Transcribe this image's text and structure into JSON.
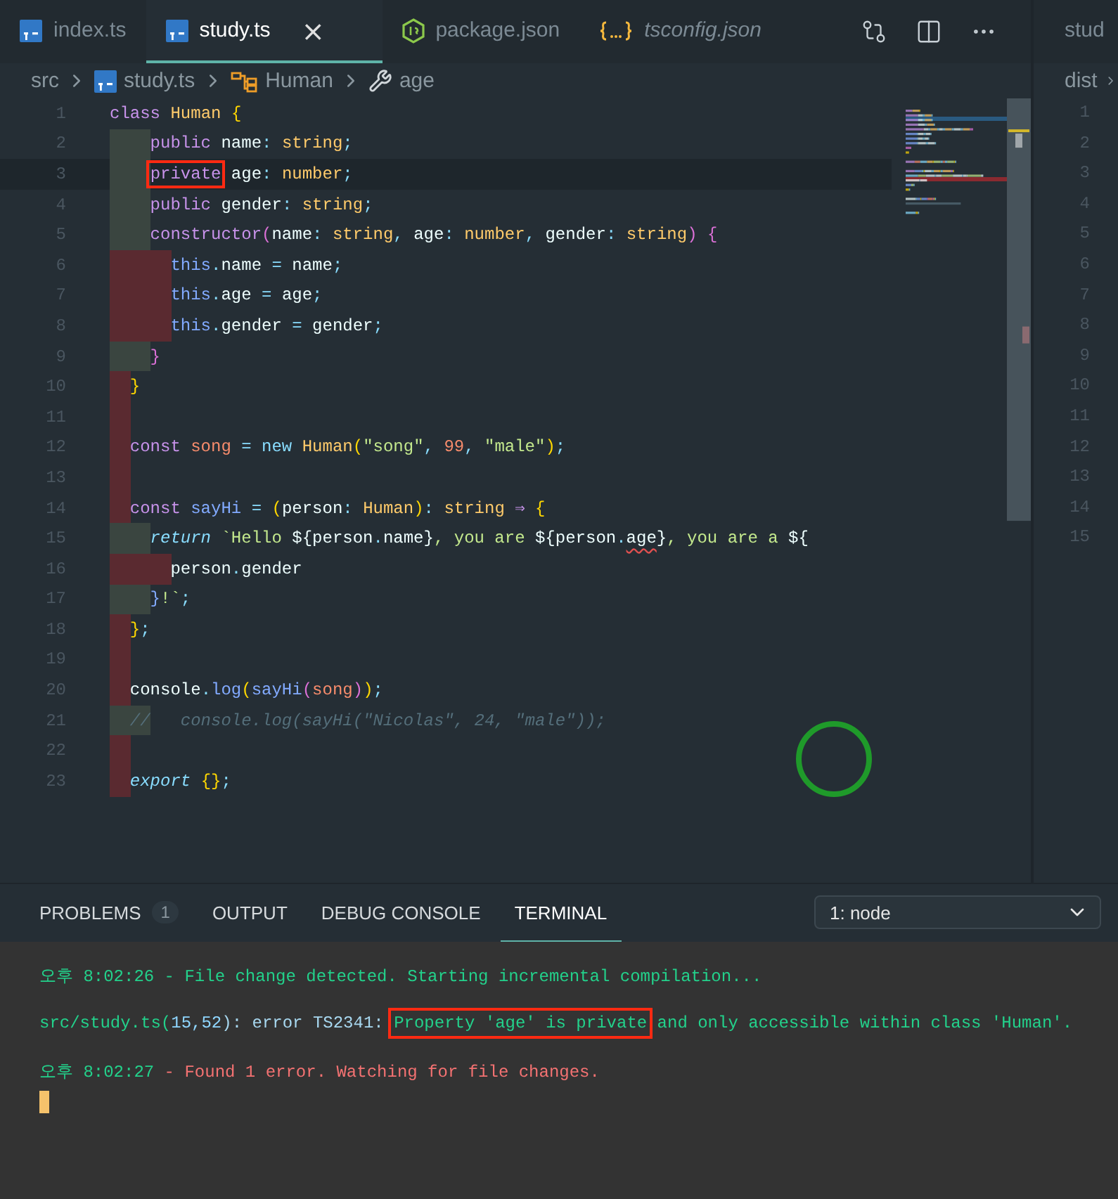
{
  "tabs": [
    {
      "label": "index.ts",
      "kind": "ts",
      "selected": false,
      "preview": false
    },
    {
      "label": "study.ts",
      "kind": "ts",
      "selected": true,
      "preview": false,
      "close": "×"
    },
    {
      "label": "package.json",
      "kind": "node",
      "selected": false,
      "preview": false
    },
    {
      "label": "tsconfig.json",
      "kind": "json",
      "selected": false,
      "preview": true
    }
  ],
  "breadcrumb": [
    {
      "label": "src",
      "kind": "folder"
    },
    {
      "label": "study.ts",
      "kind": "ts"
    },
    {
      "label": "Human",
      "kind": "class"
    },
    {
      "label": "age",
      "kind": "property"
    }
  ],
  "lines": [
    {
      "number": "1",
      "tokens": [
        {
          "kind": "kw",
          "text": "class "
        },
        {
          "kind": "type",
          "text": "Human "
        },
        {
          "kind": "brace",
          "text": "{"
        }
      ]
    },
    {
      "number": "2",
      "guides": [
        {
          "kind": "ok"
        },
        {
          "kind": "ok"
        }
      ],
      "tokens": [
        {
          "kind": "kw",
          "text": "    public "
        },
        {
          "kind": "id",
          "text": "name"
        },
        {
          "kind": "punct",
          "text": ": "
        },
        {
          "kind": "type",
          "text": "string"
        },
        {
          "kind": "punct",
          "text": ";"
        }
      ]
    },
    {
      "number": "3",
      "current": true,
      "guides": [
        {
          "kind": "ok"
        },
        {
          "kind": "ok"
        }
      ],
      "tokens": [
        {
          "kind": "kw",
          "text": "    private",
          "boxed": true
        },
        {
          "kind": "id",
          "text": " age"
        },
        {
          "kind": "punct",
          "text": ": "
        },
        {
          "kind": "type",
          "text": "number"
        },
        {
          "kind": "punct",
          "text": ";"
        }
      ]
    },
    {
      "number": "4",
      "guides": [
        {
          "kind": "ok"
        },
        {
          "kind": "ok"
        }
      ],
      "tokens": [
        {
          "kind": "kw",
          "text": "    public "
        },
        {
          "kind": "id",
          "text": "gender"
        },
        {
          "kind": "punct",
          "text": ": "
        },
        {
          "kind": "type",
          "text": "string"
        },
        {
          "kind": "punct",
          "text": ";"
        }
      ]
    },
    {
      "number": "5",
      "guides": [
        {
          "kind": "ok"
        },
        {
          "kind": "ok"
        }
      ],
      "tokens": [
        {
          "kind": "kw",
          "text": "    constructor"
        },
        {
          "kind": "paren",
          "text": "("
        },
        {
          "kind": "id",
          "text": "name"
        },
        {
          "kind": "punct",
          "text": ": "
        },
        {
          "kind": "type",
          "text": "string"
        },
        {
          "kind": "punct",
          "text": ", "
        },
        {
          "kind": "id",
          "text": "age"
        },
        {
          "kind": "punct",
          "text": ": "
        },
        {
          "kind": "type",
          "text": "number"
        },
        {
          "kind": "punct",
          "text": ", "
        },
        {
          "kind": "id",
          "text": "gender"
        },
        {
          "kind": "punct",
          "text": ": "
        },
        {
          "kind": "type",
          "text": "string"
        },
        {
          "kind": "paren",
          "text": ") {"
        }
      ]
    },
    {
      "number": "6",
      "guides": [
        {
          "kind": "err"
        },
        {
          "kind": "err"
        },
        {
          "kind": "err"
        }
      ],
      "tokens": [
        {
          "kind": "this",
          "text": "      this"
        },
        {
          "kind": "punct",
          "text": "."
        },
        {
          "kind": "id",
          "text": "name "
        },
        {
          "kind": "op",
          "text": "= "
        },
        {
          "kind": "id",
          "text": "name"
        },
        {
          "kind": "punct",
          "text": ";"
        }
      ]
    },
    {
      "number": "7",
      "guides": [
        {
          "kind": "err"
        },
        {
          "kind": "err"
        },
        {
          "kind": "err"
        }
      ],
      "tokens": [
        {
          "kind": "this",
          "text": "      this"
        },
        {
          "kind": "punct",
          "text": "."
        },
        {
          "kind": "id",
          "text": "age "
        },
        {
          "kind": "op",
          "text": "= "
        },
        {
          "kind": "id",
          "text": "age"
        },
        {
          "kind": "punct",
          "text": ";"
        }
      ]
    },
    {
      "number": "8",
      "guides": [
        {
          "kind": "err"
        },
        {
          "kind": "err"
        },
        {
          "kind": "err"
        }
      ],
      "tokens": [
        {
          "kind": "this",
          "text": "      this"
        },
        {
          "kind": "punct",
          "text": "."
        },
        {
          "kind": "id",
          "text": "gender "
        },
        {
          "kind": "op",
          "text": "= "
        },
        {
          "kind": "id",
          "text": "gender"
        },
        {
          "kind": "punct",
          "text": ";"
        }
      ]
    },
    {
      "number": "9",
      "guides": [
        {
          "kind": "ok"
        },
        {
          "kind": "ok"
        }
      ],
      "tokens": [
        {
          "kind": "paren",
          "text": "    }"
        }
      ]
    },
    {
      "number": "10",
      "guides": [
        {
          "kind": "err"
        }
      ],
      "tokens": [
        {
          "kind": "brace",
          "text": "  }"
        }
      ]
    },
    {
      "number": "11",
      "guides": [
        {
          "kind": "err"
        }
      ]
    },
    {
      "number": "12",
      "guides": [
        {
          "kind": "err"
        }
      ],
      "tokens": [
        {
          "kind": "kw",
          "text": "  const "
        },
        {
          "kind": "var",
          "text": "song "
        },
        {
          "kind": "op",
          "text": "= new "
        },
        {
          "kind": "type",
          "text": "Human"
        },
        {
          "kind": "brace",
          "text": "("
        },
        {
          "kind": "str",
          "text": "\"song\""
        },
        {
          "kind": "punct",
          "text": ", "
        },
        {
          "kind": "num",
          "text": "99"
        },
        {
          "kind": "punct",
          "text": ", "
        },
        {
          "kind": "str",
          "text": "\"male\""
        },
        {
          "kind": "brace",
          "text": ")"
        },
        {
          "kind": "punct",
          "text": ";"
        }
      ]
    },
    {
      "number": "13",
      "guides": [
        {
          "kind": "err"
        }
      ]
    },
    {
      "number": "14",
      "guides": [
        {
          "kind": "err"
        }
      ],
      "tokens": [
        {
          "kind": "kw",
          "text": "  const "
        },
        {
          "kind": "fn",
          "text": "sayHi "
        },
        {
          "kind": "op",
          "text": "= "
        },
        {
          "kind": "brace",
          "text": "("
        },
        {
          "kind": "id",
          "text": "person"
        },
        {
          "kind": "punct",
          "text": ": "
        },
        {
          "kind": "type",
          "text": "Human"
        },
        {
          "kind": "brace",
          "text": ")"
        },
        {
          "kind": "punct",
          "text": ": "
        },
        {
          "kind": "type",
          "text": "string "
        },
        {
          "kind": "kw",
          "text": "⇒ "
        },
        {
          "kind": "brace",
          "text": "{"
        }
      ]
    },
    {
      "number": "15",
      "guides": [
        {
          "kind": "ok"
        },
        {
          "kind": "ok"
        }
      ],
      "tokens": [
        {
          "kind": "ctl",
          "text": "    return "
        },
        {
          "kind": "str",
          "text": "`Hello "
        },
        {
          "kind": "id",
          "text": "${person"
        },
        {
          "kind": "punct",
          "text": "."
        },
        {
          "kind": "id",
          "text": "name}"
        },
        {
          "kind": "str",
          "text": ", you are "
        },
        {
          "kind": "id",
          "text": "${person"
        },
        {
          "kind": "punct",
          "text": "."
        },
        {
          "kind": "id",
          "text": "age",
          "squiggle": true
        },
        {
          "kind": "id",
          "text": "}"
        },
        {
          "kind": "str",
          "text": ", you are a "
        },
        {
          "kind": "id",
          "text": "${"
        }
      ]
    },
    {
      "number": "16",
      "guides": [
        {
          "kind": "err"
        },
        {
          "kind": "err"
        },
        {
          "kind": "err"
        }
      ],
      "tokens": [
        {
          "kind": "id",
          "text": "      person"
        },
        {
          "kind": "punct",
          "text": "."
        },
        {
          "kind": "id",
          "text": "gender"
        }
      ]
    },
    {
      "number": "17",
      "guides": [
        {
          "kind": "ok"
        },
        {
          "kind": "ok"
        }
      ],
      "tokens": [
        {
          "kind": "this",
          "text": "    }"
        },
        {
          "kind": "str",
          "text": "!`"
        },
        {
          "kind": "punct",
          "text": ";"
        }
      ]
    },
    {
      "number": "18",
      "guides": [
        {
          "kind": "err"
        }
      ],
      "tokens": [
        {
          "kind": "brace",
          "text": "  }"
        },
        {
          "kind": "punct",
          "text": ";"
        }
      ]
    },
    {
      "number": "19",
      "guides": [
        {
          "kind": "err"
        }
      ]
    },
    {
      "number": "20",
      "guides": [
        {
          "kind": "err"
        }
      ],
      "tokens": [
        {
          "kind": "id",
          "text": "  console"
        },
        {
          "kind": "punct",
          "text": "."
        },
        {
          "kind": "fn",
          "text": "log"
        },
        {
          "kind": "brace",
          "text": "("
        },
        {
          "kind": "fn",
          "text": "sayHi"
        },
        {
          "kind": "paren",
          "text": "("
        },
        {
          "kind": "var",
          "text": "song"
        },
        {
          "kind": "paren",
          "text": ")"
        },
        {
          "kind": "brace",
          "text": ")"
        },
        {
          "kind": "punct",
          "text": ";"
        }
      ]
    },
    {
      "number": "21",
      "guides": [
        {
          "kind": "ok"
        },
        {
          "kind": "ok"
        }
      ],
      "tokens": [
        {
          "kind": "cmt",
          "text": "  //   console.log(sayHi(\"Nicolas\", 24, \"male\"));"
        }
      ]
    },
    {
      "number": "22",
      "guides": [
        {
          "kind": "err"
        }
      ]
    },
    {
      "number": "23",
      "guides": [
        {
          "kind": "err"
        }
      ],
      "tokens": [
        {
          "kind": "ctl",
          "text": "  export "
        },
        {
          "kind": "brace",
          "text": "{}"
        },
        {
          "kind": "punct",
          "text": ";"
        }
      ]
    }
  ],
  "right_pane": {
    "tab": "stud",
    "breadcrumb": "dist",
    "line_numbers": [
      "1",
      "2",
      "3",
      "4",
      "5",
      "6",
      "7",
      "8",
      "9",
      "10",
      "11",
      "12",
      "13",
      "14",
      "15"
    ]
  },
  "panel": {
    "tabs": [
      {
        "label": "PROBLEMS",
        "badge": "1",
        "selected": false
      },
      {
        "label": "OUTPUT",
        "selected": false
      },
      {
        "label": "DEBUG CONSOLE",
        "selected": false
      },
      {
        "label": "TERMINAL",
        "selected": true
      }
    ],
    "terminal_select": "1: node",
    "terminal_lines": [
      [
        {
          "kind": "info",
          "text": "오후 8:02:26 - File change detected. Starting incremental compilation..."
        }
      ],
      [
        {
          "kind": "info",
          "text": "src/study.ts("
        },
        {
          "kind": "num",
          "text": "15,52"
        },
        {
          "kind": "plain",
          "text": "): error TS2341: "
        },
        {
          "kind": "info",
          "text": "Property 'age' is private",
          "boxed": true
        },
        {
          "kind": "info",
          "text": " and only accessible within class 'Human'."
        }
      ],
      [
        {
          "kind": "info",
          "text": "오후 8:02:27"
        },
        {
          "kind": "err",
          "text": " - Found 1 error. Watching for file changes."
        }
      ]
    ]
  }
}
